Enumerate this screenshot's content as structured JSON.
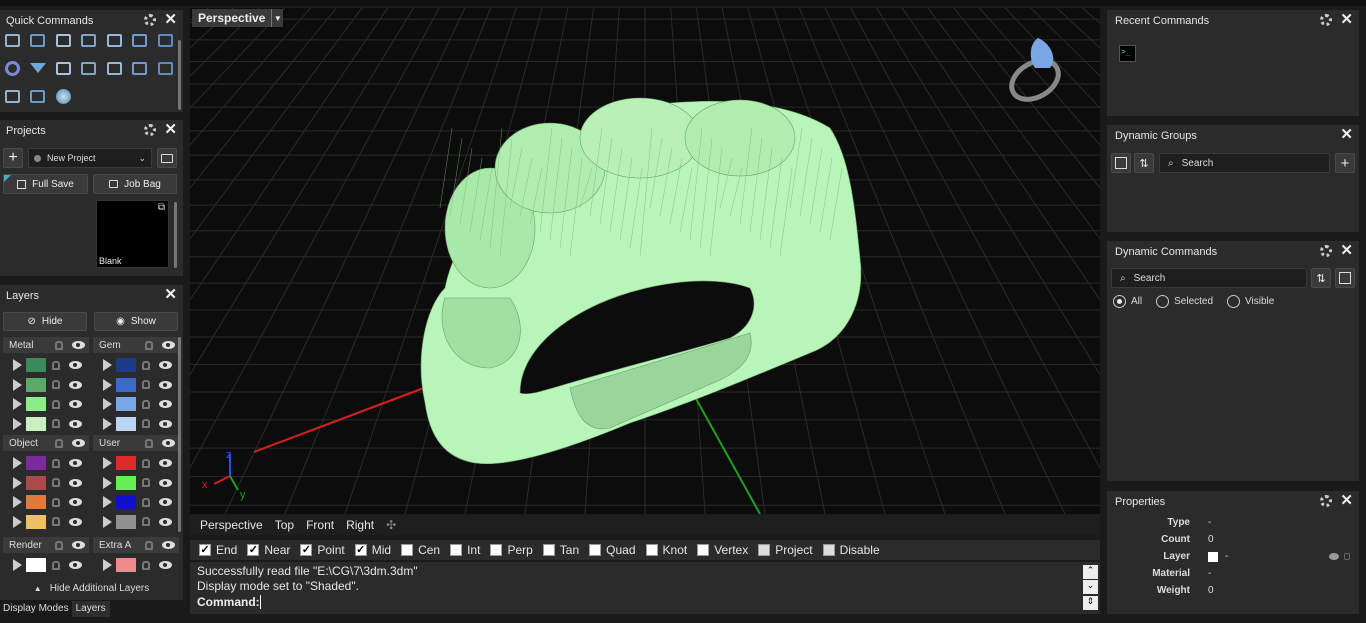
{
  "quick_commands": {
    "title": "Quick Commands",
    "icons": [
      "corner-icon",
      "arrow-icon",
      "align-icon",
      "distribute-icon",
      "scale-icon",
      "array-icon",
      "copy-icon",
      "ring-icon",
      "gem-icon",
      "spray-icon",
      "curve-icon",
      "cutter-icon",
      "bead-icon",
      "prong-icon",
      "bezel-icon",
      "pave-icon",
      "sphere-icon"
    ]
  },
  "projects": {
    "title": "Projects",
    "project_name": "New Project",
    "full_save_label": "Full Save",
    "job_bag_label": "Job Bag",
    "thumb_label": "Blank"
  },
  "layers": {
    "title": "Layers",
    "hide_label": "Hide",
    "show_label": "Show",
    "groups": [
      {
        "name": "Metal",
        "colors": [
          "#3a8a5a",
          "#5aaa6a",
          "#8aee8a",
          "#c9f0c0"
        ]
      },
      {
        "name": "Gem",
        "colors": [
          "#1a3a8a",
          "#3a6acc",
          "#7aa6e6",
          "#bcd6f4"
        ]
      },
      {
        "name": "Object",
        "colors": [
          "#7a2a9a",
          "#aa4a4a",
          "#e07a3a",
          "#eec060"
        ]
      },
      {
        "name": "User",
        "colors": [
          "#dd2a2a",
          "#66ee55",
          "#1010cc",
          "#909090"
        ]
      },
      {
        "name": "Render",
        "colors": [
          "#ffffff"
        ]
      },
      {
        "name": "Extra A",
        "colors": [
          "#ee8a8a"
        ]
      }
    ],
    "hide_additional_label": "Hide Additional Layers"
  },
  "bottom_tabs": [
    "Display Modes",
    "Layers"
  ],
  "viewport": {
    "title": "Perspective",
    "axis_labels": {
      "x": "x",
      "y": "y",
      "z": "z"
    },
    "tabs": [
      "Perspective",
      "Top",
      "Front",
      "Right"
    ],
    "add_tab_symbol": "✣"
  },
  "snaps": [
    {
      "label": "End",
      "checked": true
    },
    {
      "label": "Near",
      "checked": true
    },
    {
      "label": "Point",
      "checked": true
    },
    {
      "label": "Mid",
      "checked": true
    },
    {
      "label": "Cen",
      "checked": false
    },
    {
      "label": "Int",
      "checked": false
    },
    {
      "label": "Perp",
      "checked": false
    },
    {
      "label": "Tan",
      "checked": false
    },
    {
      "label": "Quad",
      "checked": false
    },
    {
      "label": "Knot",
      "checked": false
    },
    {
      "label": "Vertex",
      "checked": false
    },
    {
      "label": "Project",
      "checked": false,
      "disabled": true
    },
    {
      "label": "Disable",
      "checked": false,
      "disabled": true
    }
  ],
  "console": {
    "lines": [
      "Successfully read file \"E:\\CG\\7\\3dm.3dm\"",
      "Display mode set to \"Shaded\"."
    ],
    "prompt": "Command:"
  },
  "recent_commands": {
    "title": "Recent Commands",
    "icon_text": ">_"
  },
  "dynamic_groups": {
    "title": "Dynamic Groups",
    "search_placeholder": "Search"
  },
  "dynamic_commands": {
    "title": "Dynamic Commands",
    "search_placeholder": "Search",
    "filters": [
      {
        "label": "All",
        "selected": true
      },
      {
        "label": "Selected",
        "selected": false
      },
      {
        "label": "Visible",
        "selected": false
      }
    ]
  },
  "properties": {
    "title": "Properties",
    "rows": [
      {
        "label": "Type",
        "value": "-"
      },
      {
        "label": "Count",
        "value": "0"
      },
      {
        "label": "Layer",
        "value": "-"
      },
      {
        "label": "Material",
        "value": "-"
      },
      {
        "label": "Weight",
        "value": "0"
      }
    ]
  },
  "colors": {
    "accent_mesh": "#b8f5b8",
    "axis_x": "#d42020",
    "axis_y": "#20a020",
    "axis_z": "#3050e0"
  }
}
